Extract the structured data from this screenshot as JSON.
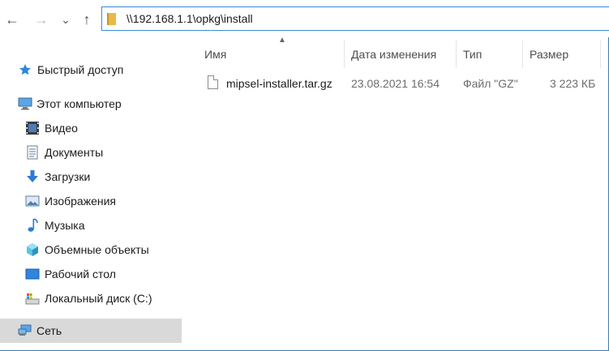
{
  "address": {
    "path": "\\\\192.168.1.1\\opkg\\install"
  },
  "nav": {
    "back": "←",
    "forward": "→",
    "recent": "⌄",
    "up": "↑"
  },
  "sidebar": {
    "items": [
      {
        "label": "Быстрый доступ",
        "icon": "star-icon"
      },
      {
        "label": "Этот компьютер",
        "icon": "computer-icon"
      },
      {
        "label": "Видео",
        "icon": "video-icon"
      },
      {
        "label": "Документы",
        "icon": "documents-icon"
      },
      {
        "label": "Загрузки",
        "icon": "downloads-icon"
      },
      {
        "label": "Изображения",
        "icon": "pictures-icon"
      },
      {
        "label": "Музыка",
        "icon": "music-icon"
      },
      {
        "label": "Объемные объекты",
        "icon": "3d-objects-icon"
      },
      {
        "label": "Рабочий стол",
        "icon": "desktop-icon"
      },
      {
        "label": "Локальный диск (C:)",
        "icon": "drive-icon"
      },
      {
        "label": "Сеть",
        "icon": "network-icon"
      }
    ]
  },
  "columns": {
    "name": "Имя",
    "date": "Дата изменения",
    "type": "Тип",
    "size": "Размер"
  },
  "files": [
    {
      "name": "mipsel-installer.tar.gz",
      "date": "23.08.2021 16:54",
      "type": "Файл \"GZ\"",
      "size": "3 223 КБ"
    }
  ],
  "colors": {
    "accent": "#3a8bd8",
    "selected_bg": "#d9d9d9",
    "folder": "#e8b84a"
  }
}
